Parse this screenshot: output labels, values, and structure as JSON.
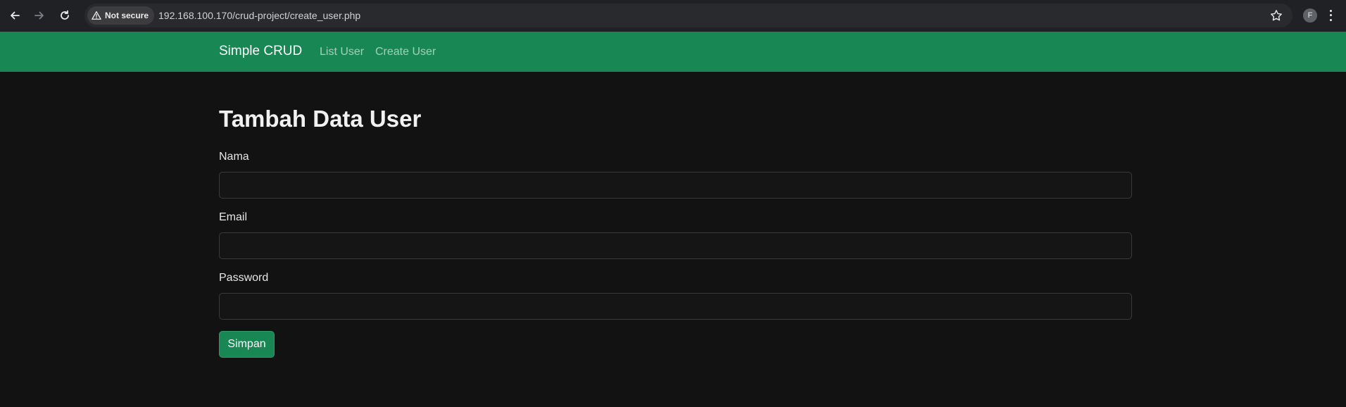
{
  "browser": {
    "security_label": "Not secure",
    "url": "192.168.100.170/crud-project/create_user.php",
    "profile_initial": "F",
    "icons": [
      "back-arrow-icon",
      "forward-arrow-icon",
      "reload-icon",
      "warning-icon",
      "star-icon",
      "kebab-menu-icon"
    ]
  },
  "navbar": {
    "brand": "Simple CRUD",
    "links": [
      {
        "label": "List User"
      },
      {
        "label": "Create User"
      }
    ],
    "color": "#198754"
  },
  "form": {
    "title": "Tambah Data User",
    "fields": [
      {
        "label": "Nama",
        "value": ""
      },
      {
        "label": "Email",
        "value": ""
      },
      {
        "label": "Password",
        "value": ""
      }
    ],
    "submit_label": "Simpan"
  },
  "colors": {
    "background": "#121212",
    "accent": "#198754"
  }
}
